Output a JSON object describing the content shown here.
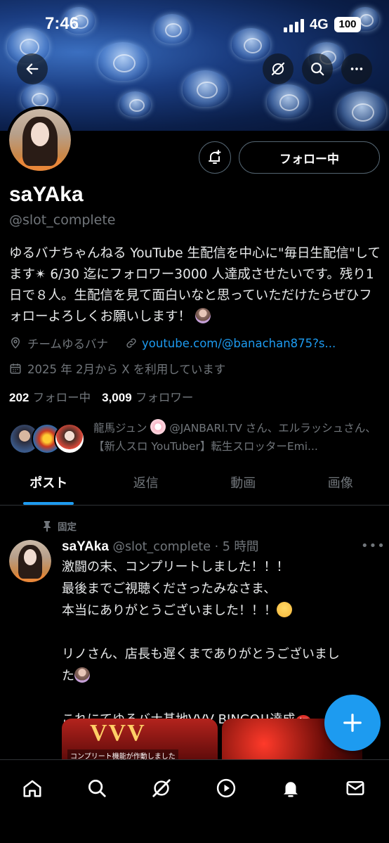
{
  "status": {
    "time": "7:46",
    "network": "4G",
    "battery": "100"
  },
  "profile": {
    "name": "saYAka",
    "handle": "@slot_complete",
    "follow_label": "フォロー中",
    "bio": "ゆるバナちゃんねる YouTube 生配信を中心に\"毎日生配信\"してます✴ 6/30 迄にフォロワー3000 人達成させたいです。残り1日で８人。生配信を見て面白いなと思っていただけたらぜひフォローよろしくお願いします！",
    "location": "チームゆるバナ",
    "link": "youtube.com/@banachan875?s...",
    "joined": "2025 年 2月から X を利用しています",
    "following_count": "202",
    "following_label": "フォロー中",
    "followers_count": "3,009",
    "followers_label": "フォロワー",
    "known_followers_name": "龍馬ジュン",
    "known_followers_rest": "@JANBARI.TV さん、エルラッシュさん、【新人スロ YouTuber】転生スロッターEmi..."
  },
  "tabs": [
    "ポスト",
    "返信",
    "動画",
    "画像"
  ],
  "post": {
    "pinned_label": "固定",
    "author": "saYAka",
    "handle_time": "@slot_complete · 5 時間",
    "line1": "激闘の末、コンプリートしました！！！",
    "line2": "最後までご視聴くださったみなさま、",
    "line3": "本当にありがとうございました！！！",
    "line4": "リノさん、店長も遅くまでありがとうございまし",
    "line5": "た",
    "line6": "これにてゆるバナ基地VVV BINGO!!達成",
    "media_overlay": "コンプリート機能が作動しました",
    "media_logo": "VVV",
    "iwai": "祝"
  },
  "icons": {
    "back": "back-arrow-icon",
    "grok": "grok-icon",
    "search": "search-icon",
    "more": "more-icon",
    "bell": "notification-add-icon",
    "location": "location-icon",
    "link": "link-icon",
    "calendar": "calendar-icon",
    "pin": "pin-icon",
    "compose": "plus-icon"
  },
  "colors": {
    "accent": "#1d9bf0",
    "muted": "#71767b",
    "text": "#e7e9ea",
    "background": "#000000"
  }
}
